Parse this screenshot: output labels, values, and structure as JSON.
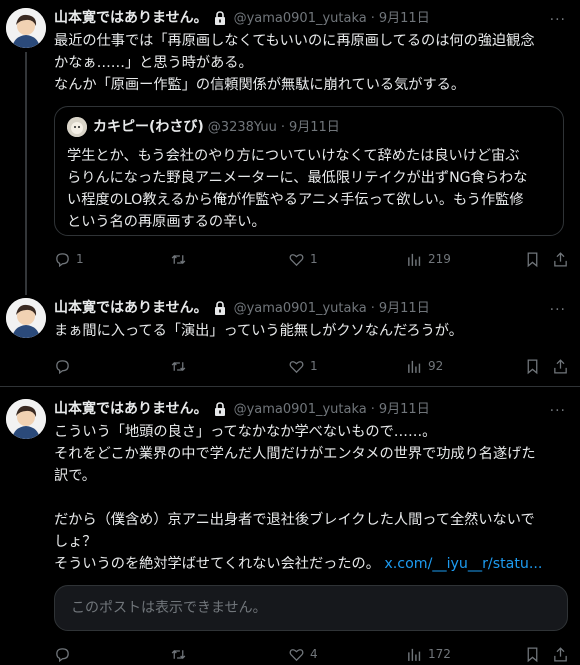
{
  "colors": {
    "background": "#000000",
    "text": "#e7e9ea",
    "muted": "#71767b",
    "link": "#1d9bf0",
    "border": "#2f3336"
  },
  "tweets": [
    {
      "author": "山本寛ではありません。",
      "handle": "@yama0901_yutaka",
      "sep": "·",
      "date": "9月11日",
      "more": "···",
      "text": "最近の仕事では「再原画しなくてもいいのに再原画してるのは何の強迫観念\nかなぁ……」と思う時がある。\nなんか「原画ー作監」の信頼関係が無駄に崩れている気がする。",
      "quote": {
        "author": "カキピー(わさび)",
        "handle": "@3238Yuu",
        "sep": "·",
        "date": "9月11日",
        "text": "学生とか、もう会社のやり方についていけなくて辞めたは良いけど宙ぶ\nらりんになった野良アニメーターに、最低限リテイクが出ずNG食らわな\nい程度のLO教えるから俺が作監やるアニメ手伝って欲しい。もう作監修\nという名の再原画するの辛い。"
      },
      "counts": {
        "replies": "1",
        "retweets": "",
        "likes": "1",
        "views": "219"
      }
    },
    {
      "author": "山本寛ではありません。",
      "handle": "@yama0901_yutaka",
      "sep": "·",
      "date": "9月11日",
      "more": "···",
      "text": "まぁ間に入ってる「演出」っていう能無しがクソなんだろうが。",
      "counts": {
        "replies": "",
        "retweets": "",
        "likes": "1",
        "views": "92"
      }
    },
    {
      "author": "山本寛ではありません。",
      "handle": "@yama0901_yutaka",
      "sep": "·",
      "date": "9月11日",
      "more": "···",
      "text": "こういう「地頭の良さ」ってなかなか学べないもので……。\nそれをどこか業界の中で学んだ人間だけがエンタメの世界で功成り名遂げた\n訳で。\n\nだから（僕含め）京アニ出身者で退社後ブレイクした人間って全然いないで\nしょ？\nそういうのを絶対学ばせてくれない会社だったの。 ",
      "link": "x.com/__iyu__r/statu...",
      "unavailable": "このポストは表示できません。",
      "counts": {
        "replies": "",
        "retweets": "",
        "likes": "4",
        "views": "172"
      }
    }
  ]
}
